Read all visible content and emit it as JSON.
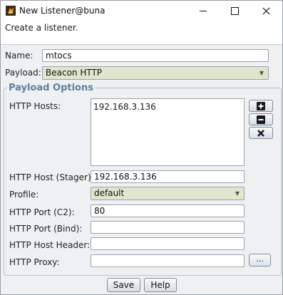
{
  "window": {
    "title": "New Listener@buna",
    "icon": "cobalt-strike-app-icon"
  },
  "description": "Create a listener.",
  "form": {
    "name": {
      "label": "Name:",
      "value": "mtocs"
    },
    "payload": {
      "label": "Payload:",
      "value": "Beacon HTTP"
    }
  },
  "payload_options": {
    "title": "Payload Options",
    "http_hosts": {
      "label": "HTTP Hosts:",
      "items": [
        "192.168.3.136"
      ]
    },
    "http_host_stager": {
      "label": "HTTP Host (Stager):",
      "value": "192.168.3.136"
    },
    "profile": {
      "label": "Profile:",
      "value": "default"
    },
    "http_port_c2": {
      "label": "HTTP Port (C2):",
      "value": "80"
    },
    "http_port_bind": {
      "label": "HTTP Port (Bind):",
      "value": ""
    },
    "http_host_header": {
      "label": "HTTP Host Header:",
      "value": ""
    },
    "http_proxy": {
      "label": "HTTP Proxy:",
      "value": "",
      "browse_label": "..."
    }
  },
  "buttons": {
    "save": "Save",
    "help": "Help"
  },
  "colors": {
    "group_title": "#5f7ea3",
    "combo_bg": "#e0e5cf",
    "window_bg": "#eef0f2"
  }
}
